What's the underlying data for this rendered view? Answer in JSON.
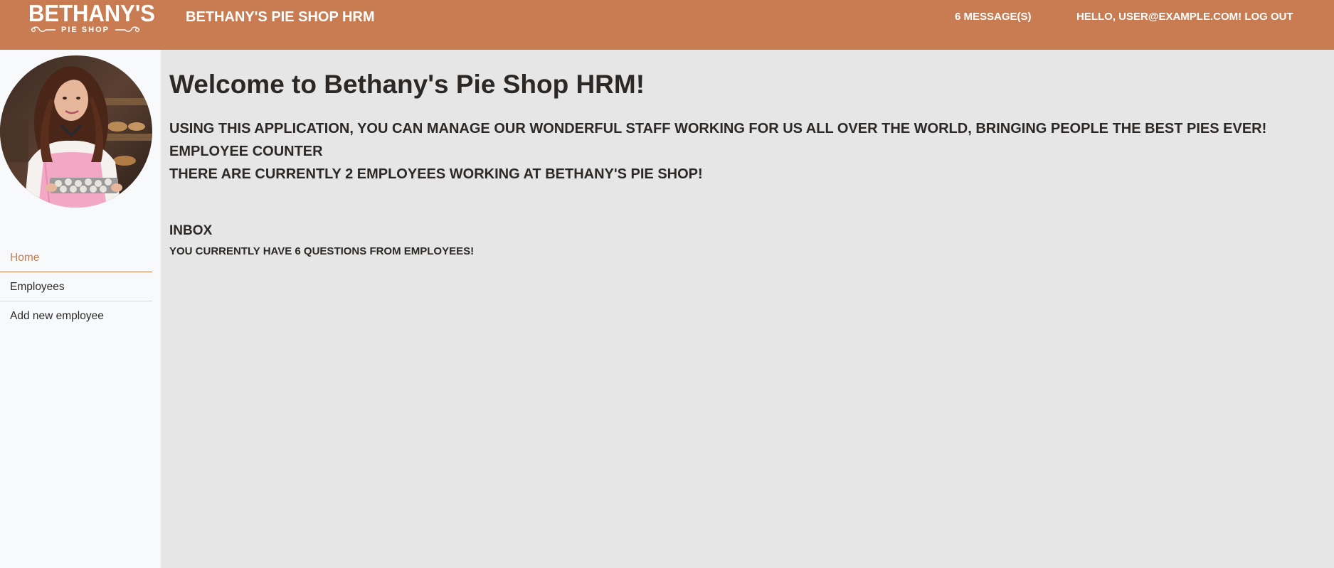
{
  "header": {
    "logo_word": "BETHANY'S",
    "logo_sub": "PIE SHOP",
    "app_title": "BETHANY'S PIE SHOP HRM",
    "messages_link": "6 MESSAGE(S)",
    "greeting": "HELLO, USER@EXAMPLE.COM!",
    "logout_label": "LOG OUT"
  },
  "sidebar": {
    "items": [
      {
        "label": "Home",
        "active": true
      },
      {
        "label": "Employees",
        "active": false
      },
      {
        "label": "Add new employee",
        "active": false
      }
    ]
  },
  "main": {
    "welcome_title": "Welcome to Bethany's Pie Shop HRM!",
    "intro": "USING THIS APPLICATION, YOU CAN MANAGE OUR WONDERFUL STAFF WORKING FOR US ALL OVER THE WORLD, BRINGING PEOPLE THE BEST PIES EVER!",
    "counter_title": "EMPLOYEE COUNTER",
    "counter_text": "THERE ARE CURRENTLY 2 EMPLOYEES WORKING AT BETHANY'S PIE SHOP!",
    "inbox_title": "INBOX",
    "inbox_text": "YOU CURRENTLY HAVE 6 QUESTIONS FROM EMPLOYEES!"
  },
  "colors": {
    "brand": "#c97c51",
    "page_background": "#e6e6e6",
    "sidebar_background": "#f8f9fa",
    "text_dark": "#2c2825"
  },
  "icons": {
    "logo": "bethanys-pie-shop-logo",
    "avatar": "user-avatar-photo"
  }
}
